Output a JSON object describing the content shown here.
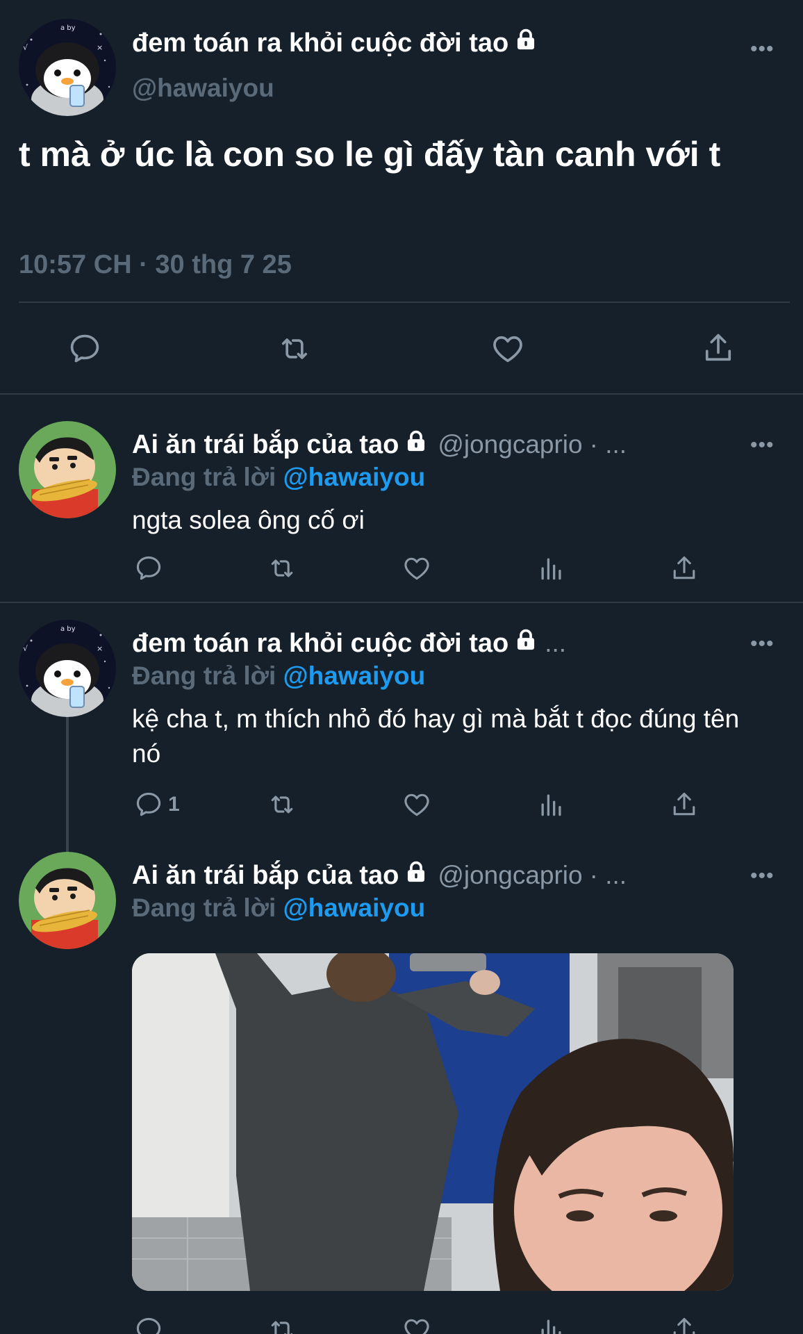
{
  "main_tweet": {
    "author_name": "đem toán ra khỏi cuộc đời tao",
    "handle": "@hawaiyou",
    "text": "t mà ở úc là con so le gì đấy tàn canh với t",
    "timestamp": "10:57 CH · 30 thg 7 25",
    "more_label": "•••",
    "avatar_icon": "penguin-avatar",
    "lock_icon": "lock-icon"
  },
  "replies": [
    {
      "author_name": "Ai ăn trái bắp của tao",
      "handle": "@jongcaprio",
      "separator": "· ...",
      "replying_prefix": "Đang trả lời",
      "replying_to": "@hawaiyou",
      "text": "ngta solea ông cố ơi",
      "reply_count": "",
      "more_label": "•••",
      "avatar_icon": "shinchan-avatar"
    },
    {
      "author_name": "đem toán ra khỏi cuộc đời tao",
      "handle": "",
      "separator": "...",
      "replying_prefix": "Đang trả lời",
      "replying_to": "@hawaiyou",
      "text": "kệ cha t, m thích nhỏ đó hay gì mà bắt t đọc đúng tên nó",
      "reply_count": "1",
      "more_label": "•••",
      "avatar_icon": "penguin-avatar"
    },
    {
      "author_name": "Ai ăn trái bắp của tao",
      "handle": "@jongcaprio",
      "separator": "· ...",
      "replying_prefix": "Đang trả lời",
      "replying_to": "@hawaiyou",
      "text": "",
      "reply_count": "",
      "more_label": "•••",
      "avatar_icon": "shinchan-avatar",
      "media": "photo"
    }
  ],
  "colors": {
    "background": "#15202b",
    "secondary_text": "#8b98a5",
    "muted_text": "#5b6a78",
    "link": "#1d9bf0",
    "divider": "#2f3b47"
  }
}
